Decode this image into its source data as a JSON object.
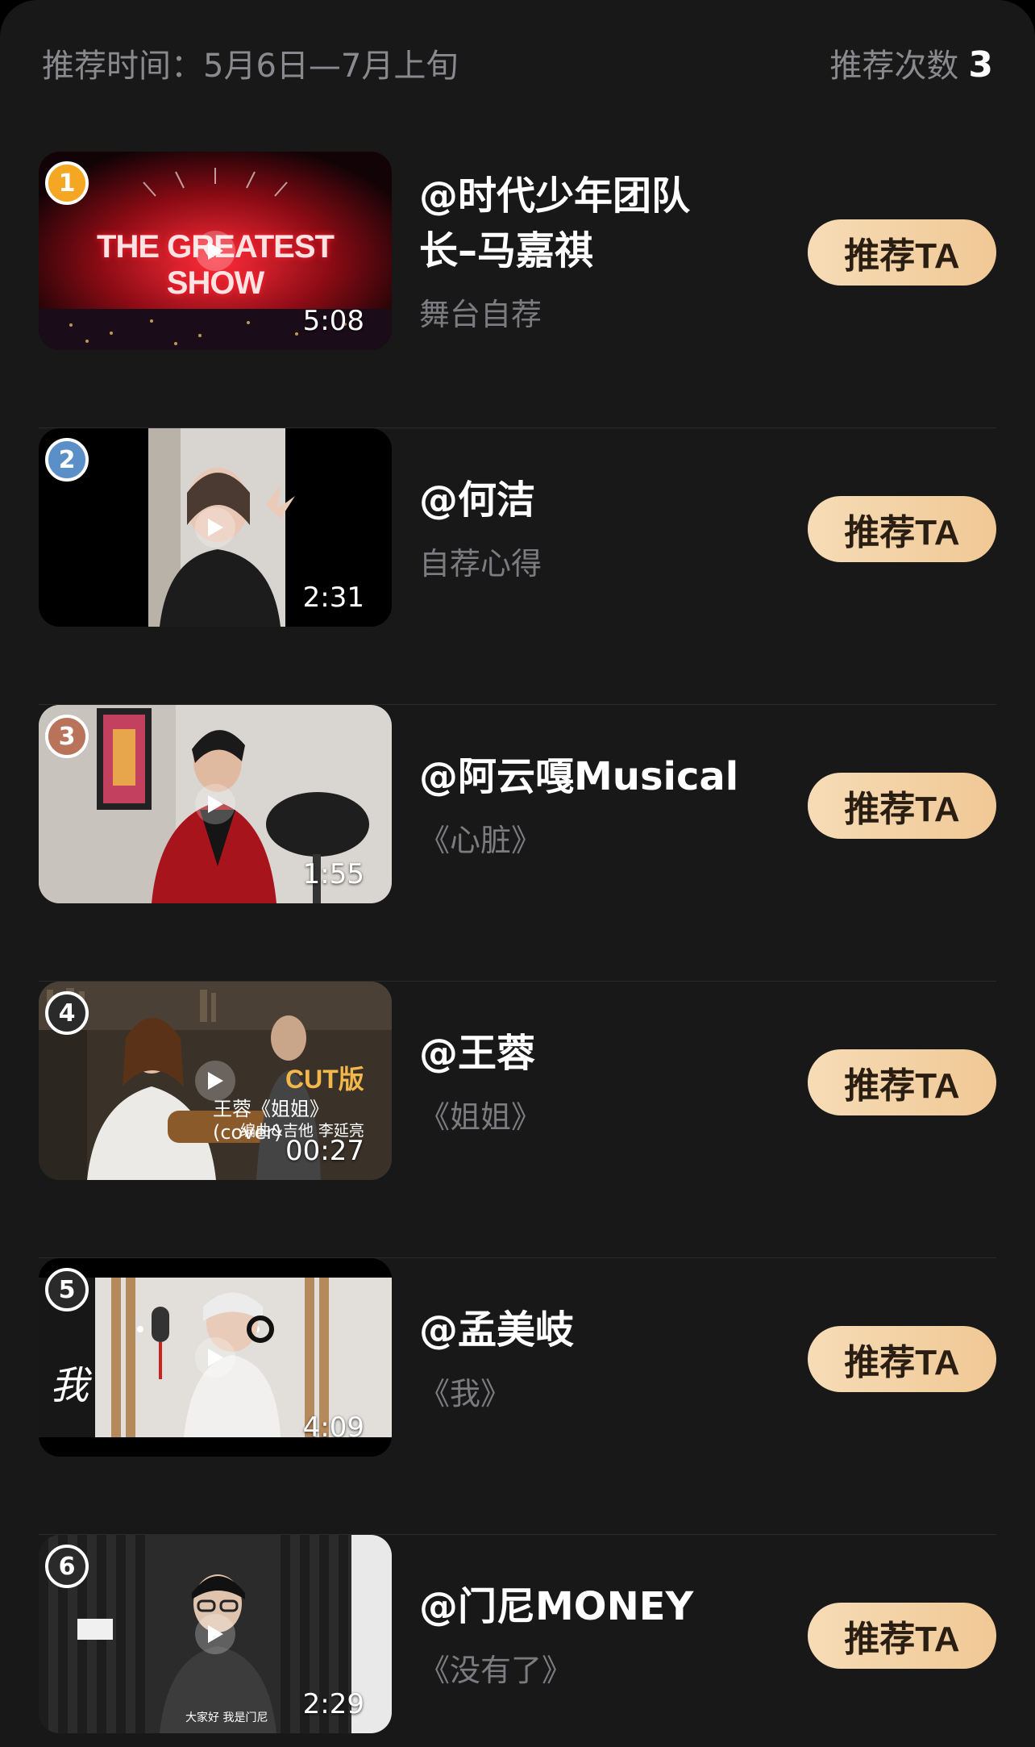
{
  "header": {
    "period_label": "推荐时间：5月6日—7月上旬",
    "count_label": "推荐次数",
    "count_value": "3"
  },
  "colors": {
    "background": "#181819",
    "button_gradient_start": "#f6dcb6",
    "button_gradient_end": "#f0c895",
    "rank_gold": "#f5a623",
    "rank_silver": "#5a8fc8",
    "rank_bronze": "#b8735a"
  },
  "items": [
    {
      "rank": "1",
      "name_line1": "@时代少年团队",
      "name_line2": "长–马嘉祺",
      "subtitle": "舞台自荐",
      "duration": "5:08",
      "button": "推荐TA",
      "thumb_text": "THE GREATEST SHOW"
    },
    {
      "rank": "2",
      "name_line1": "@何洁",
      "name_line2": "",
      "subtitle": "自荐心得",
      "duration": "2:31",
      "button": "推荐TA"
    },
    {
      "rank": "3",
      "name_line1": "@阿云嘎Musical",
      "name_line2": "",
      "subtitle": "《心脏》",
      "duration": "1:55",
      "button": "推荐TA"
    },
    {
      "rank": "4",
      "name_line1": "@王蓉",
      "name_line2": "",
      "subtitle": "《姐姐》",
      "duration": "00:27",
      "button": "推荐TA",
      "thumb_text_1": "CUT版",
      "thumb_text_2": "王蓉《姐姐》(cover)",
      "thumb_text_3": "编曲&吉他  李延亮"
    },
    {
      "rank": "5",
      "name_line1": "@孟美岐",
      "name_line2": "",
      "subtitle": "《我》",
      "duration": "4:09",
      "button": "推荐TA",
      "thumb_text": "我"
    },
    {
      "rank": "6",
      "name_line1": "@门尼MONEY",
      "name_line2": "",
      "subtitle": "《没有了》",
      "duration": "2:29",
      "button": "推荐TA",
      "thumb_text": "大家好 我是门尼"
    }
  ]
}
